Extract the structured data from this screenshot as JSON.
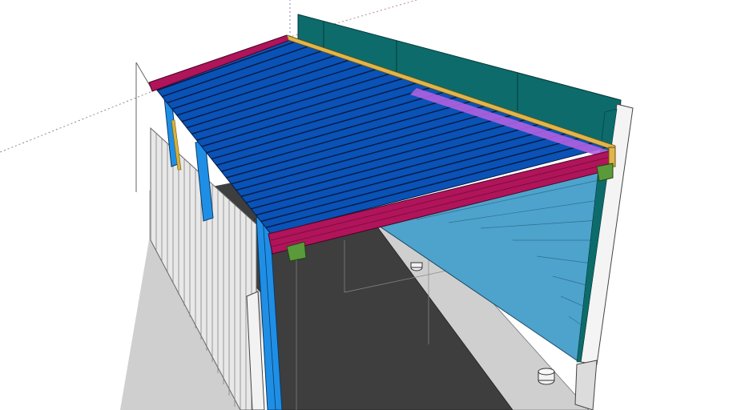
{
  "viewport": {
    "background_color": "#ffffff",
    "axes_visible": true,
    "edges_visible": true
  },
  "model": {
    "roof_color": "#0a52b5",
    "beam_color": "#b0145a",
    "post_color": "#1f8fe6",
    "rear_wall_color": "#0d6b6b",
    "infill_color": "#4da3cc",
    "floor_color": "#3e3e3e",
    "fence_color": "#e6e6e6",
    "roof_sheet_count": 24
  }
}
